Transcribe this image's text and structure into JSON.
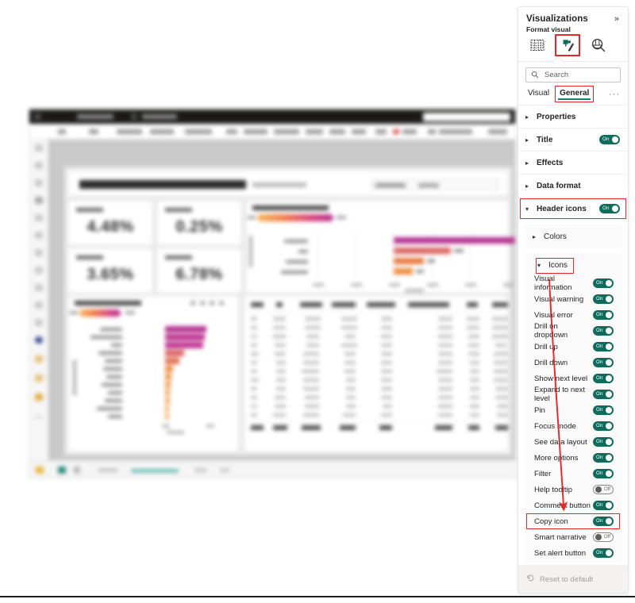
{
  "report_preview": {
    "kpis": [
      {
        "value": "4.48%"
      },
      {
        "value": "0.25%"
      },
      {
        "value": "3.65%"
      },
      {
        "value": "6.78%"
      }
    ]
  },
  "pane": {
    "title": "Visualizations",
    "collapse_icon": "»",
    "format_label": "Format visual",
    "icons": [
      {
        "name": "fields-table-icon",
        "selected": false
      },
      {
        "name": "format-paint-roller-icon",
        "selected": true
      },
      {
        "name": "analytics-magnifier-icon",
        "selected": false
      }
    ],
    "search": {
      "placeholder": "Search",
      "value": "",
      "icon": "search-icon"
    },
    "tabs": [
      {
        "label": "Visual",
        "active": false,
        "highlighted": false
      },
      {
        "label": "General",
        "active": true,
        "highlighted": true
      }
    ],
    "tab_more": "···",
    "sections": [
      {
        "label": "Properties",
        "expanded": false,
        "toggle": null,
        "highlighted": false
      },
      {
        "label": "Title",
        "expanded": false,
        "toggle": "On",
        "highlighted": false
      },
      {
        "label": "Effects",
        "expanded": false,
        "toggle": null,
        "highlighted": false
      },
      {
        "label": "Data format",
        "expanded": false,
        "toggle": null,
        "highlighted": false
      },
      {
        "label": "Header icons",
        "expanded": true,
        "toggle": "On",
        "highlighted": true
      }
    ],
    "subsections": [
      {
        "label": "Colors",
        "expanded": false,
        "highlighted": false
      },
      {
        "label": "Icons",
        "expanded": true,
        "highlighted": true
      }
    ],
    "icon_options": [
      {
        "label": "Visual information",
        "state": "On",
        "highlighted": false
      },
      {
        "label": "Visual warning",
        "state": "On",
        "highlighted": false
      },
      {
        "label": "Visual error",
        "state": "On",
        "highlighted": false
      },
      {
        "label": "Drill on dropdown",
        "state": "On",
        "highlighted": false
      },
      {
        "label": "Drill up",
        "state": "On",
        "highlighted": false
      },
      {
        "label": "Drill down",
        "state": "On",
        "highlighted": false
      },
      {
        "label": "Show next level",
        "state": "On",
        "highlighted": false
      },
      {
        "label": "Expand to next level",
        "state": "On",
        "highlighted": false
      },
      {
        "label": "Pin",
        "state": "On",
        "highlighted": false
      },
      {
        "label": "Focus mode",
        "state": "On",
        "highlighted": false
      },
      {
        "label": "See data layout",
        "state": "On",
        "highlighted": false
      },
      {
        "label": "More options",
        "state": "On",
        "highlighted": false
      },
      {
        "label": "Filter",
        "state": "On",
        "highlighted": false
      },
      {
        "label": "Help tooltip",
        "state": "Off",
        "highlighted": false
      },
      {
        "label": "Comment button",
        "state": "On",
        "highlighted": false
      },
      {
        "label": "Copy icon",
        "state": "On",
        "highlighted": true
      },
      {
        "label": "Smart narrative",
        "state": "Off",
        "highlighted": false
      },
      {
        "label": "Set alert button",
        "state": "On",
        "highlighted": false
      }
    ],
    "footer": {
      "label": "Reset to default",
      "icon": "reset-arrow-icon"
    }
  },
  "annotation": {
    "arrow_color": "#e8262a",
    "highlight_color": "#e8262a"
  },
  "toggle_text": {
    "on": "On",
    "off": "Off"
  }
}
